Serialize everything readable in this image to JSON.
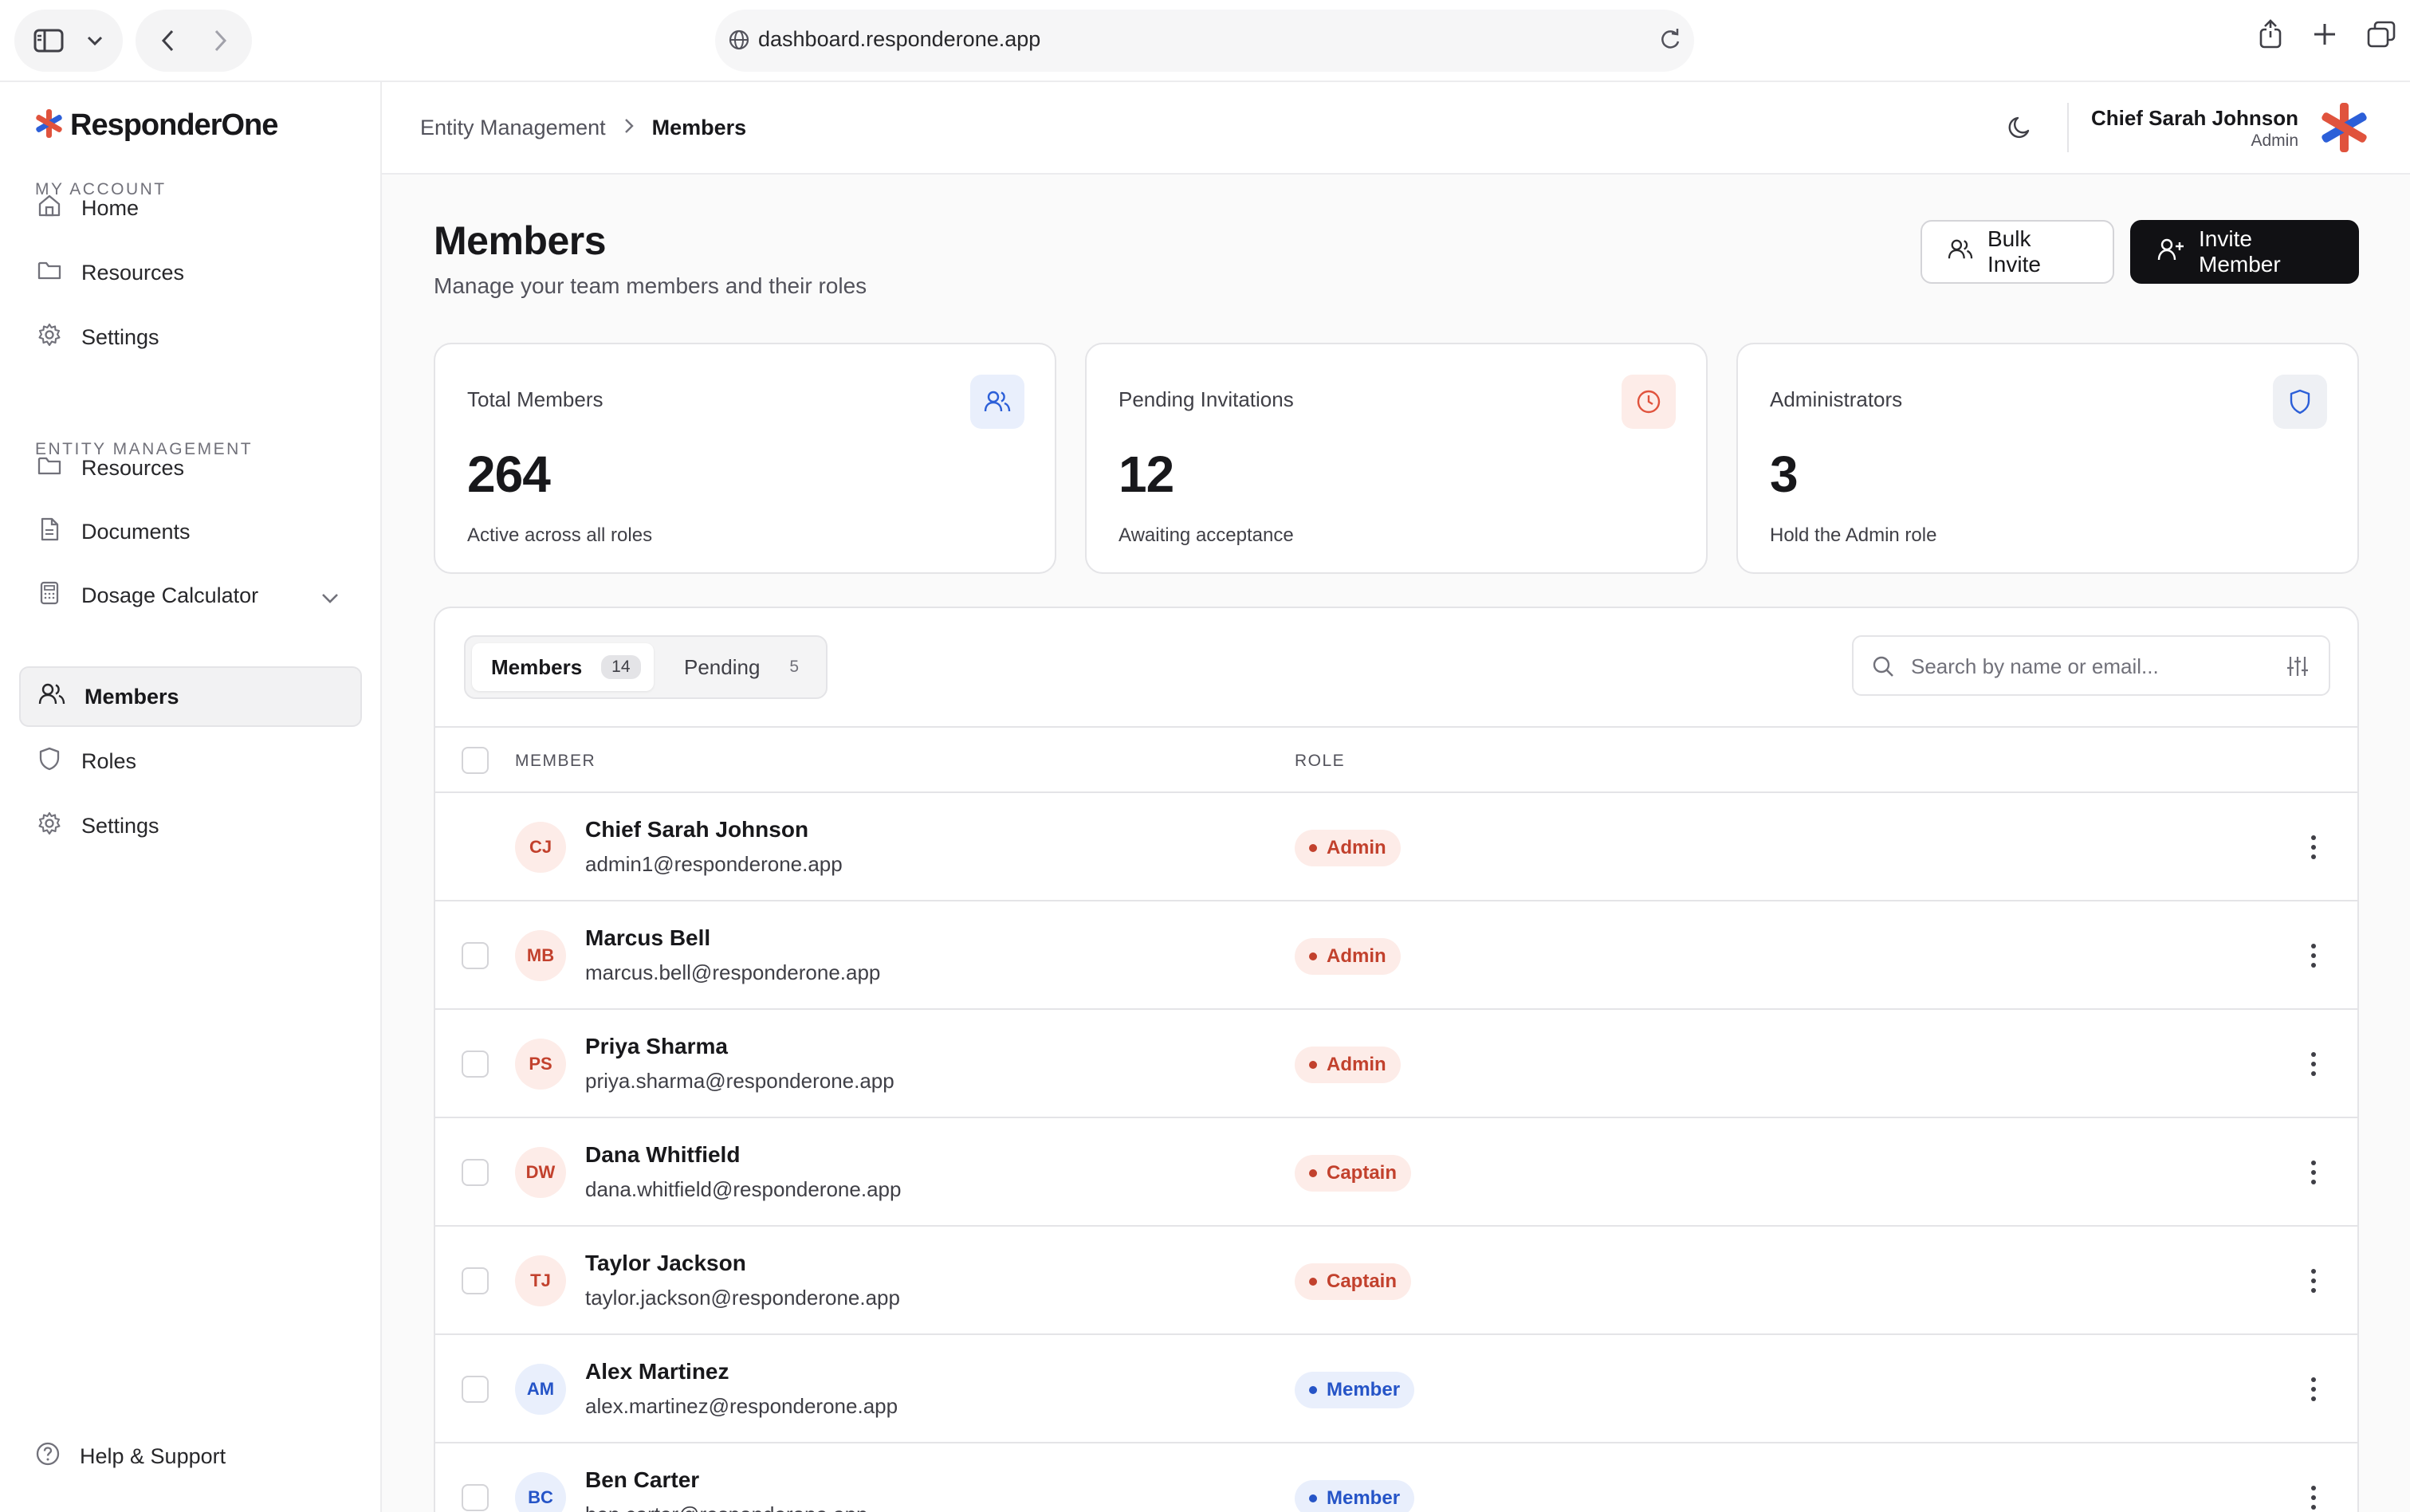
{
  "browser": {
    "url": "dashboard.responderone.app"
  },
  "brand": {
    "name": "ResponderOne",
    "accent": "#e0533d",
    "accent_blue": "#2c5fd8"
  },
  "sidebar": {
    "my_account_label": "MY ACCOUNT",
    "my_account_items": [
      {
        "label": "Home",
        "icon": "home-icon"
      },
      {
        "label": "Resources",
        "icon": "folder-icon"
      },
      {
        "label": "Settings",
        "icon": "gear-icon"
      }
    ],
    "entity_label": "ENTITY MANAGEMENT",
    "entity_items": [
      {
        "label": "Resources",
        "icon": "folder-icon"
      },
      {
        "label": "Documents",
        "icon": "document-icon"
      },
      {
        "label": "Dosage Calculator",
        "icon": "calculator-icon"
      },
      {
        "label": "Members",
        "icon": "users-icon",
        "active": true
      },
      {
        "label": "Roles",
        "icon": "shield-icon"
      },
      {
        "label": "Settings",
        "icon": "gear-icon"
      }
    ],
    "help_label": "Help & Support"
  },
  "topbar": {
    "breadcrumb_parent": "Entity Management",
    "breadcrumb_current": "Members",
    "user_name": "Chief Sarah Johnson",
    "user_role": "Admin"
  },
  "page": {
    "title": "Members",
    "subtitle": "Manage your team members and their roles",
    "bulk_invite_label": "Bulk Invite",
    "invite_label": "Invite Member"
  },
  "stats": [
    {
      "label": "Total Members",
      "value": "264",
      "desc": "Active across all roles",
      "icon": "users-icon"
    },
    {
      "label": "Pending Invitations",
      "value": "12",
      "desc": "Awaiting acceptance",
      "icon": "clock-icon"
    },
    {
      "label": "Administrators",
      "value": "3",
      "desc": "Hold the Admin role",
      "icon": "shield-icon"
    }
  ],
  "tabs": [
    {
      "label": "Members",
      "count": "14",
      "active": true
    },
    {
      "label": "Pending",
      "count": "5",
      "active": false
    }
  ],
  "search": {
    "placeholder": "Search by name or email..."
  },
  "table": {
    "columns": [
      "MEMBER",
      "ROLE"
    ],
    "rows": [
      {
        "initials": "CJ",
        "name": "Chief Sarah Johnson",
        "email": "admin1@responderone.app",
        "role": "Admin",
        "self": true
      },
      {
        "initials": "MB",
        "name": "Marcus Bell",
        "email": "marcus.bell@responderone.app",
        "role": "Admin"
      },
      {
        "initials": "PS",
        "name": "Priya Sharma",
        "email": "priya.sharma@responderone.app",
        "role": "Admin"
      },
      {
        "initials": "DW",
        "name": "Dana Whitfield",
        "email": "dana.whitfield@responderone.app",
        "role": "Captain"
      },
      {
        "initials": "TJ",
        "name": "Taylor Jackson",
        "email": "taylor.jackson@responderone.app",
        "role": "Captain"
      },
      {
        "initials": "AM",
        "name": "Alex Martinez",
        "email": "alex.martinez@responderone.app",
        "role": "Member"
      },
      {
        "initials": "BC",
        "name": "Ben Carter",
        "email": "ben.carter@responderone.app",
        "role": "Member"
      }
    ]
  },
  "colors": {
    "admin_bg": "#fdece8",
    "admin_text": "#c2412d",
    "member_bg": "#e9effc",
    "member_text": "#2554c7"
  }
}
